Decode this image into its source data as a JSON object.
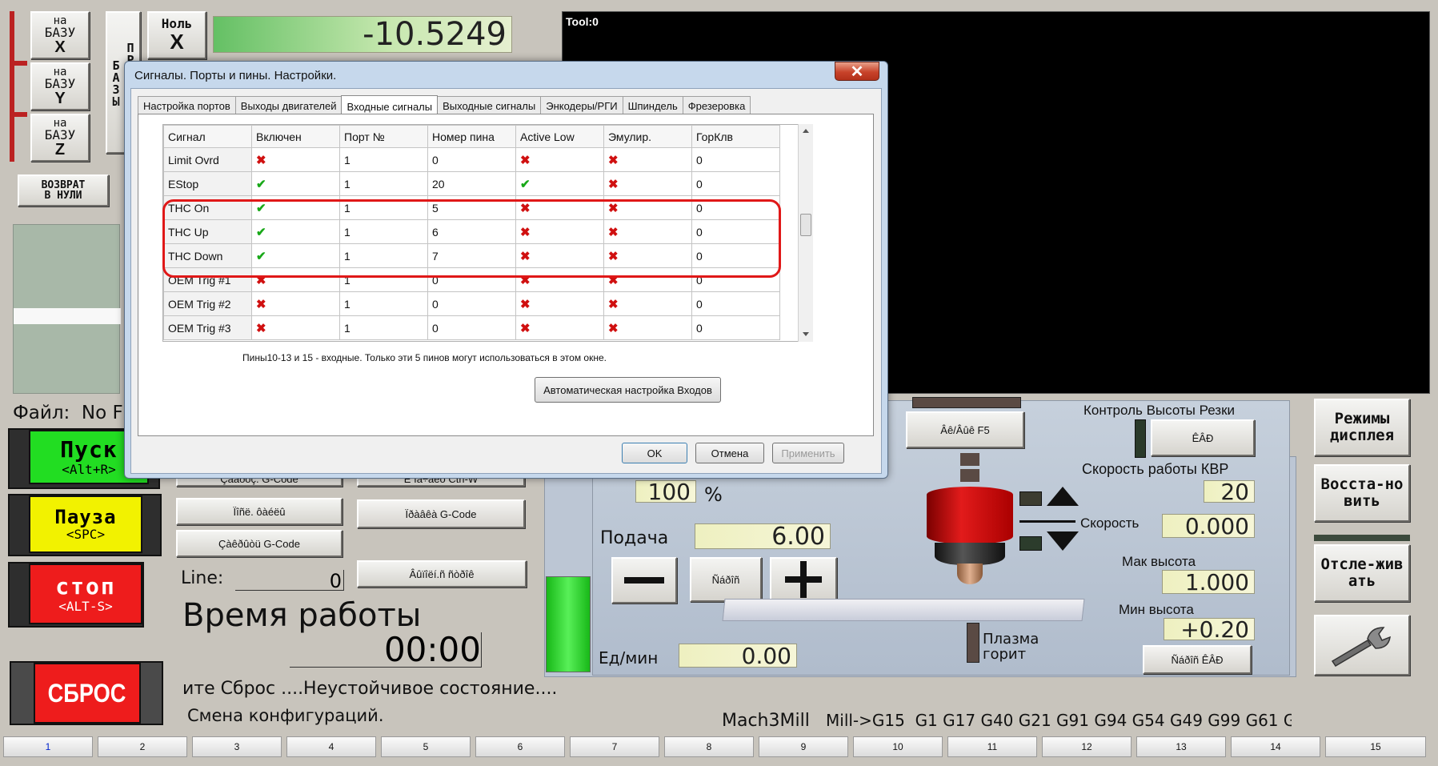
{
  "ref_buttons": [
    {
      "top": "на",
      "mid": "БАЗУ",
      "axis": "X"
    },
    {
      "top": "на",
      "mid": "БАЗУ",
      "axis": "Y"
    },
    {
      "top": "на",
      "mid": "БАЗУ",
      "axis": "Z"
    }
  ],
  "zero_x": {
    "top": "Ноль",
    "axis": "X"
  },
  "vertical_btn_text": "ПРИНЯТЬ БАЗЫ",
  "dro_x_value": "-10.5249",
  "return_to_zero": "ВОЗВРАТ В НУЛИ",
  "tool_label": "Tool:0",
  "file_label": "Файл:  No F",
  "cycle_start": {
    "label": "Пуск",
    "hotkey": "<Alt+R>"
  },
  "pause": {
    "label": "Пауза",
    "hotkey": "<SPC>"
  },
  "stop": {
    "label": "стоп",
    "hotkey": "<ALT-S>"
  },
  "reset_label": "СБРОС",
  "gcode_buttons": {
    "load": "Çàãðóç. G-Code",
    "edit_top": "Ê ïà÷àëó Ctrl-W",
    "recent": "Ïîñë. ôàéëû",
    "edit": "Ïðàâêà G-Code",
    "close": "Çàêðûòü G-Code",
    "redo": "Âûïîëí.ñ ñòðîê"
  },
  "line_label": "Line:",
  "line_value": "0",
  "runtime_label": "Время работы",
  "runtime_value": "00:00",
  "status_line1": "ите Сброс ....Неустойчивое состояние....",
  "status_line2": "Смена конфигураций.",
  "profile": "Mach3Mill",
  "gcodes": "Mill->G15  G1 G17 G40 G21 G91 G94 G54 G49 G99 G61 G",
  "feed_pct": "100",
  "pct_sign": "%",
  "feed_label": "Подача",
  "feed_value": "6.00",
  "feed_reset_btn": "Ñáðîñ",
  "units_label": "Ед/мин",
  "units_value": "0.00",
  "f5_btn": "Âê/Âûê F5",
  "thc_title": "Контроль Высоты Резки",
  "thc_btn": "ÊÂÐ",
  "thc_speed_label": "Скорость работы КВР",
  "thc_speed_value": "20",
  "speed_label": "Скорость",
  "speed_value": "0.000",
  "max_h_label": "Мак высота",
  "max_h_value": "1.000",
  "min_h_label": "Мин высота",
  "min_h_value": "+0.20",
  "plasma_label": "Плазма горит",
  "thc_reset_btn": "Ñáðîñ ÊÂÐ",
  "side_buttons": [
    "Режимы дисплея",
    "Восста-новить",
    "Отсле-живать"
  ],
  "bottom_tabs": [
    "1",
    "2",
    "3",
    "4",
    "5",
    "6",
    "7",
    "8",
    "9",
    "10",
    "11",
    "12",
    "13",
    "14",
    "15"
  ],
  "dialog": {
    "title": "Сигналы. Порты и пины. Настройки.",
    "close_glyph": "✕",
    "tabs": [
      "Настройка портов",
      "Выходы двигателей",
      "Входные сигналы",
      "Выходные сигналы",
      "Энкодеры/РГИ",
      "Шпиндель",
      "Фрезеровка"
    ],
    "active_tab": 2,
    "columns": [
      "Сигнал",
      "Включен",
      "Порт №",
      "Номер пина",
      "Active Low",
      "Эмулир.",
      "ГорКлв"
    ],
    "rows": [
      {
        "signal": "Limit Ovrd",
        "enabled": false,
        "port": "1",
        "pin": "0",
        "active_low": false,
        "emulated": false,
        "hotkey": "0"
      },
      {
        "signal": "EStop",
        "enabled": true,
        "port": "1",
        "pin": "20",
        "active_low": true,
        "emulated": false,
        "hotkey": "0"
      },
      {
        "signal": "THC On",
        "enabled": true,
        "port": "1",
        "pin": "5",
        "active_low": false,
        "emulated": false,
        "hotkey": "0"
      },
      {
        "signal": "THC Up",
        "enabled": true,
        "port": "1",
        "pin": "6",
        "active_low": false,
        "emulated": false,
        "hotkey": "0"
      },
      {
        "signal": "THC Down",
        "enabled": true,
        "port": "1",
        "pin": "7",
        "active_low": false,
        "emulated": false,
        "hotkey": "0"
      },
      {
        "signal": "OEM Trig #1",
        "enabled": false,
        "port": "1",
        "pin": "0",
        "active_low": false,
        "emulated": false,
        "hotkey": "0"
      },
      {
        "signal": "OEM Trig #2",
        "enabled": false,
        "port": "1",
        "pin": "0",
        "active_low": false,
        "emulated": false,
        "hotkey": "0"
      },
      {
        "signal": "OEM Trig #3",
        "enabled": false,
        "port": "1",
        "pin": "0",
        "active_low": false,
        "emulated": false,
        "hotkey": "0"
      }
    ],
    "note": "Пины10-13 и 15 - входные. Только эти 5 пинов могут использоваться в этом окне.",
    "auto_btn": "Автоматическая настройка Входов",
    "ok": "OK",
    "cancel": "Отмена",
    "apply": "Применить"
  },
  "colors": {
    "highlight": "#e01818",
    "check_yes": "#18a818",
    "check_no": "#d01010",
    "start_green": "#22dd22",
    "pause_yellow": "#f2f200",
    "stop_red": "#ee1c1c"
  }
}
